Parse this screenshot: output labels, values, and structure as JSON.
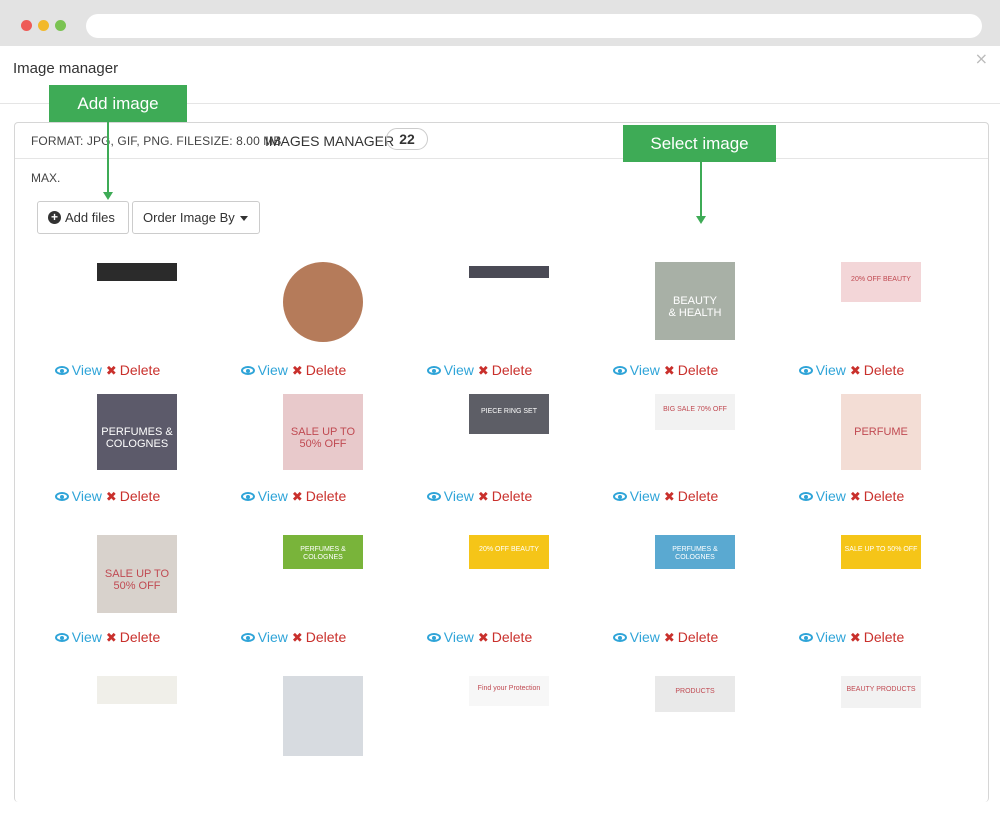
{
  "modal": {
    "title": "Image manager",
    "close": "×"
  },
  "panel": {
    "format": "FORMAT: JPG, GIF, PNG. FILESIZE: 8.00 MB",
    "manager_label": "IMAGES MANAGER",
    "count": "22",
    "max": "MAX."
  },
  "toolbar": {
    "add_files": "Add files",
    "order_by": "Order Image By"
  },
  "actions": {
    "view": "View",
    "delete": "Delete"
  },
  "callouts": {
    "add_image": "Add image",
    "select_image": "Select image"
  },
  "images": [
    {
      "bg": "#2b2b2b",
      "text": ""
    },
    {
      "bg": "#b57b5a",
      "text": ""
    },
    {
      "bg": "#4a4a55",
      "text": ""
    },
    {
      "bg": "#a8b0a6",
      "text": "BEAUTY\n& HEALTH"
    },
    {
      "bg": "#f3d6d8",
      "text": "20% OFF BEAUTY"
    },
    {
      "bg": "#5c5a6a",
      "text": "PERFUMES & COLOGNES"
    },
    {
      "bg": "#e8c9cb",
      "text": "SALE UP TO 50% OFF"
    },
    {
      "bg": "#5d5e66",
      "text": "PIECE RING SET"
    },
    {
      "bg": "#f2f2f2",
      "text": "BIG SALE 70% OFF"
    },
    {
      "bg": "#f3ddd5",
      "text": "PERFUME"
    },
    {
      "bg": "#d8d2cc",
      "text": "SALE UP TO 50% OFF"
    },
    {
      "bg": "#79b43a",
      "text": "PERFUMES & COLOGNES"
    },
    {
      "bg": "#f5c518",
      "text": "20% OFF BEAUTY"
    },
    {
      "bg": "#5aa9d1",
      "text": "PERFUMES & COLOGNES"
    },
    {
      "bg": "#f5c518",
      "text": "SALE UP TO 50% OFF"
    },
    {
      "bg": "#f0efe9",
      "text": ""
    },
    {
      "bg": "#d7dbe0",
      "text": ""
    },
    {
      "bg": "#f7f7f7",
      "text": "Find your Protection"
    },
    {
      "bg": "#e9e9e9",
      "text": "PRODUCTS"
    },
    {
      "bg": "#f2f2f2",
      "text": "BEAUTY PRODUCTS"
    }
  ]
}
